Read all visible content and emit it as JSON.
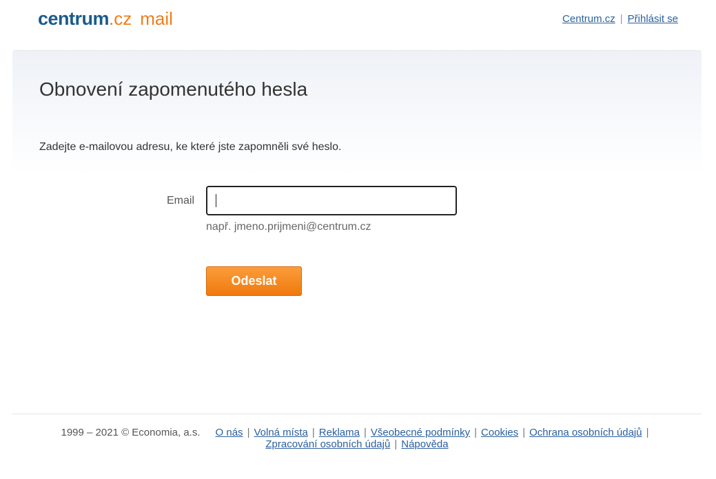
{
  "header": {
    "logo_centrum": "centrum",
    "logo_cz": ".cz",
    "logo_mail": "mail",
    "links": [
      {
        "label": "Centrum.cz"
      },
      {
        "label": "Přihlásit se"
      }
    ],
    "separator": "|"
  },
  "main": {
    "title": "Obnovení zapomenutého hesla",
    "instruction": "Zadejte e-mailovou adresu, ke které jste zapomněli své heslo.",
    "email_label": "Email",
    "email_value": "",
    "email_hint": "např. jmeno.prijmeni@centrum.cz",
    "submit_label": "Odeslat"
  },
  "footer": {
    "copyright": "1999 – 2021 © Economia, a.s.",
    "links": [
      {
        "label": "O nás"
      },
      {
        "label": "Volná místa"
      },
      {
        "label": "Reklama"
      },
      {
        "label": "Všeobecné podmínky"
      },
      {
        "label": "Cookies"
      },
      {
        "label": "Ochrana osobních údajů"
      },
      {
        "label": "Zpracování osobních údajů"
      },
      {
        "label": "Nápověda"
      }
    ],
    "separator": "|"
  },
  "colors": {
    "brand_blue": "#1a5b8c",
    "brand_orange": "#f07d1a",
    "link": "#2a5f9e",
    "button": "#f0790c"
  }
}
